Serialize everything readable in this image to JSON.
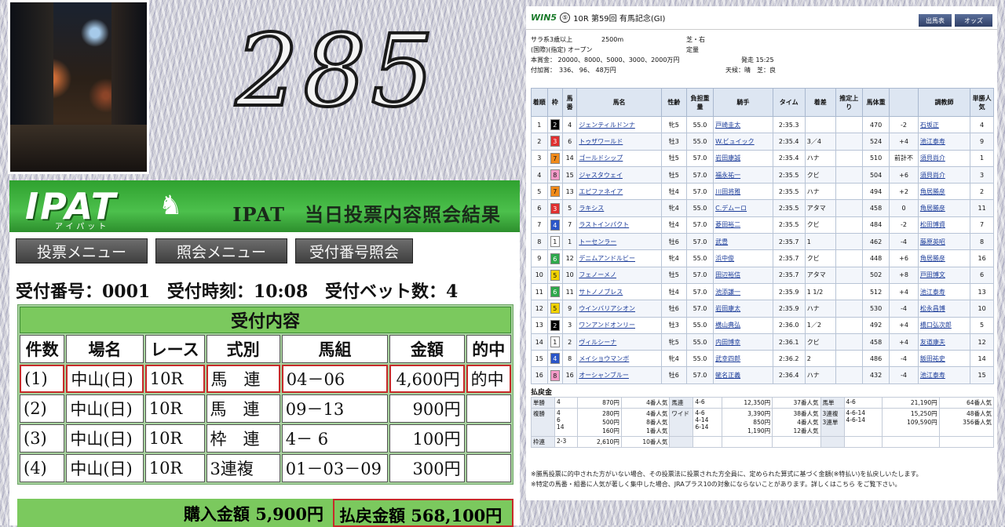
{
  "overlay": {
    "big_number": "285"
  },
  "ipat": {
    "logo": "IPAT",
    "logo_sub": "アイパット",
    "title": "IPAT　当日投票内容照会結果",
    "menu": [
      "投票メニュー",
      "照会メニュー",
      "受付番号照会"
    ],
    "info": {
      "receipt_no": "受付番号：0001",
      "receipt_time": "受付時刻：10:08",
      "bet_count": "受付ベット数：4"
    },
    "table_banner": "受付内容",
    "columns": [
      "件数",
      "場名",
      "レース",
      "式別",
      "馬組",
      "金額",
      "的中"
    ],
    "rows": [
      {
        "n": "(1)",
        "venue": "中山(日)",
        "race": "10R",
        "type": "馬　連",
        "combo": "04－06",
        "amount": "4,600円",
        "hit": "的中"
      },
      {
        "n": "(2)",
        "venue": "中山(日)",
        "race": "10R",
        "type": "馬　連",
        "combo": "09－13",
        "amount": "900円",
        "hit": ""
      },
      {
        "n": "(3)",
        "venue": "中山(日)",
        "race": "10R",
        "type": "枠　連",
        "combo": "4－ 6",
        "amount": "100円",
        "hit": ""
      },
      {
        "n": "(4)",
        "venue": "中山(日)",
        "race": "10R",
        "type": "3連複",
        "combo": "01－03－09",
        "amount": "300円",
        "hit": ""
      }
    ],
    "total_buy": "購入金額 5,900円",
    "total_pay": "払戻金額 568,100円"
  },
  "results": {
    "win5_label": "WIN5",
    "win5_circle": "⑤",
    "race_title": "10R 第59回 有馬記念(GI)",
    "buttons": [
      "出馬表",
      "オッズ"
    ],
    "cond_line1": [
      "サラ系3歳以上",
      "2500m",
      "芝・右"
    ],
    "cond_line2": [
      "(国際)(指定) オープン",
      "定量"
    ],
    "cond_line3": [
      "本賞金： 20000、8000、5000、3000、2000万円",
      "発走 15:25"
    ],
    "cond_line4": [
      "付加賞：　336、 96、 48万円",
      "天候：晴　芝：良"
    ],
    "columns": [
      "着順",
      "枠",
      "馬番",
      "馬名",
      "性齢",
      "負担重量",
      "騎手",
      "タイム",
      "着差",
      "推定上り",
      "馬体重",
      "",
      "調教師",
      "単勝人気"
    ],
    "rows": [
      {
        "rank": "1",
        "waku": "2",
        "num": "4",
        "horse": "ジェンティルドンナ",
        "sex": "牝5",
        "wt": "55.0",
        "jockey": "戸崎圭太",
        "time": "2:35.3",
        "margin": "",
        "agari": "",
        "bw": "470",
        "bd": "-2",
        "trainer": "石坂正",
        "pop": "4"
      },
      {
        "rank": "2",
        "waku": "3",
        "num": "6",
        "horse": "トゥザワールド",
        "sex": "牡3",
        "wt": "55.0",
        "jockey": "W.ビュイック",
        "time": "2:35.4",
        "margin": "3／4",
        "agari": "",
        "bw": "524",
        "bd": "+4",
        "trainer": "池江泰寿",
        "pop": "9"
      },
      {
        "rank": "3",
        "waku": "7",
        "num": "14",
        "horse": "ゴールドシップ",
        "sex": "牡5",
        "wt": "57.0",
        "jockey": "岩田康誠",
        "time": "2:35.4",
        "margin": "ハナ",
        "agari": "",
        "bw": "510",
        "bd": "前計不",
        "trainer": "須貝尚介",
        "pop": "1"
      },
      {
        "rank": "4",
        "waku": "8",
        "num": "15",
        "horse": "ジャスタウェイ",
        "sex": "牡5",
        "wt": "57.0",
        "jockey": "福永祐一",
        "time": "2:35.5",
        "margin": "クビ",
        "agari": "",
        "bw": "504",
        "bd": "+6",
        "trainer": "須貝尚介",
        "pop": "3"
      },
      {
        "rank": "5",
        "waku": "7",
        "num": "13",
        "horse": "エピファネイア",
        "sex": "牡4",
        "wt": "57.0",
        "jockey": "川田将雅",
        "time": "2:35.5",
        "margin": "ハナ",
        "agari": "",
        "bw": "494",
        "bd": "+2",
        "trainer": "角居勝彦",
        "pop": "2"
      },
      {
        "rank": "6",
        "waku": "3",
        "num": "5",
        "horse": "ラキシス",
        "sex": "牝4",
        "wt": "55.0",
        "jockey": "C.デムーロ",
        "time": "2:35.5",
        "margin": "アタマ",
        "agari": "",
        "bw": "458",
        "bd": "0",
        "trainer": "角居勝彦",
        "pop": "11"
      },
      {
        "rank": "7",
        "waku": "4",
        "num": "7",
        "horse": "ラストインパクト",
        "sex": "牡4",
        "wt": "57.0",
        "jockey": "菱田裕二",
        "time": "2:35.5",
        "margin": "クビ",
        "agari": "",
        "bw": "484",
        "bd": "-2",
        "trainer": "松田博資",
        "pop": "7"
      },
      {
        "rank": "8",
        "waku": "1",
        "num": "1",
        "horse": "トーセンラー",
        "sex": "牡6",
        "wt": "57.0",
        "jockey": "武豊",
        "time": "2:35.7",
        "margin": "1",
        "agari": "",
        "bw": "462",
        "bd": "-4",
        "trainer": "藤原英昭",
        "pop": "8"
      },
      {
        "rank": "9",
        "waku": "6",
        "num": "12",
        "horse": "デニムアンドルビー",
        "sex": "牝4",
        "wt": "55.0",
        "jockey": "浜中俊",
        "time": "2:35.7",
        "margin": "クビ",
        "agari": "",
        "bw": "448",
        "bd": "+6",
        "trainer": "角居勝彦",
        "pop": "16"
      },
      {
        "rank": "10",
        "waku": "5",
        "num": "10",
        "horse": "フェノーメノ",
        "sex": "牡5",
        "wt": "57.0",
        "jockey": "田辺裕信",
        "time": "2:35.7",
        "margin": "アタマ",
        "agari": "",
        "bw": "502",
        "bd": "+8",
        "trainer": "戸田博文",
        "pop": "6"
      },
      {
        "rank": "11",
        "waku": "6",
        "num": "11",
        "horse": "サトノノブレス",
        "sex": "牡4",
        "wt": "57.0",
        "jockey": "池添謙一",
        "time": "2:35.9",
        "margin": "1 1/2",
        "agari": "",
        "bw": "512",
        "bd": "+4",
        "trainer": "池江泰寿",
        "pop": "13"
      },
      {
        "rank": "12",
        "waku": "5",
        "num": "9",
        "horse": "ウインバリアシオン",
        "sex": "牡6",
        "wt": "57.0",
        "jockey": "岩田康太",
        "time": "2:35.9",
        "margin": "ハナ",
        "agari": "",
        "bw": "530",
        "bd": "-4",
        "trainer": "松永昌博",
        "pop": "10"
      },
      {
        "rank": "13",
        "waku": "2",
        "num": "3",
        "horse": "ワンアンドオンリー",
        "sex": "牡3",
        "wt": "55.0",
        "jockey": "横山典弘",
        "time": "2:36.0",
        "margin": "1／2",
        "agari": "",
        "bw": "492",
        "bd": "+4",
        "trainer": "橋口弘次郎",
        "pop": "5"
      },
      {
        "rank": "14",
        "waku": "1",
        "num": "2",
        "horse": "ヴィルシーナ",
        "sex": "牝5",
        "wt": "55.0",
        "jockey": "内田博幸",
        "time": "2:36.1",
        "margin": "クビ",
        "agari": "",
        "bw": "458",
        "bd": "+4",
        "trainer": "友道康夫",
        "pop": "12"
      },
      {
        "rank": "15",
        "waku": "4",
        "num": "8",
        "horse": "メイショウマンボ",
        "sex": "牝4",
        "wt": "55.0",
        "jockey": "武幸四郎",
        "time": "2:36.2",
        "margin": "2",
        "agari": "",
        "bw": "486",
        "bd": "-4",
        "trainer": "飯田祐史",
        "pop": "14"
      },
      {
        "rank": "16",
        "waku": "8",
        "num": "16",
        "horse": "オーシャンブルー",
        "sex": "牡6",
        "wt": "57.0",
        "jockey": "蛯名正義",
        "time": "2:36.4",
        "margin": "ハナ",
        "agari": "",
        "bw": "432",
        "bd": "-4",
        "trainer": "池江泰寿",
        "pop": "15"
      }
    ],
    "payout_title": "払戻金",
    "payout": [
      [
        "単勝",
        "4",
        "870円",
        "4番人気",
        "馬連",
        "4-6",
        "12,350円",
        "37番人気",
        "馬単",
        "4-6",
        "21,190円",
        "64番人気"
      ],
      [
        "複勝",
        "4\n6\n14",
        "280円\n500円\n160円",
        "4番人気\n8番人気\n1番人気",
        "ワイド",
        "4-6\n4-14\n6-14",
        "3,390円\n850円\n1,190円",
        "38番人気\n4番人気\n12番人気",
        "3連複\n3連単",
        "4-6-14\n4-6-14",
        "15,250円\n109,590円",
        "48番人気\n356番人気"
      ],
      [
        "枠連",
        "2-3",
        "2,610円",
        "10番人気",
        "",
        "",
        "",
        "",
        "",
        "",
        "",
        ""
      ]
    ],
    "note1": "※勝馬投票に的中された方がいない場合、その投票法に投票された方全員に、定められた算式に基づく金額(※特払い)を払戻しいたします。",
    "note2": "※特定の馬番・組番に人気が著しく集中した場合、JRAプラス10の対象にならないことがあります。詳しくはこちら をご覧下さい。"
  },
  "colors": {
    "ipat_green": "#4cc04c",
    "hit_red": "#c62a2a",
    "waku": {
      "1": "#ffffff",
      "2": "#000000",
      "3": "#e03030",
      "4": "#2a55c8",
      "5": "#f2d200",
      "6": "#2ea84b",
      "7": "#f08a1a",
      "8": "#f59ac8"
    }
  }
}
